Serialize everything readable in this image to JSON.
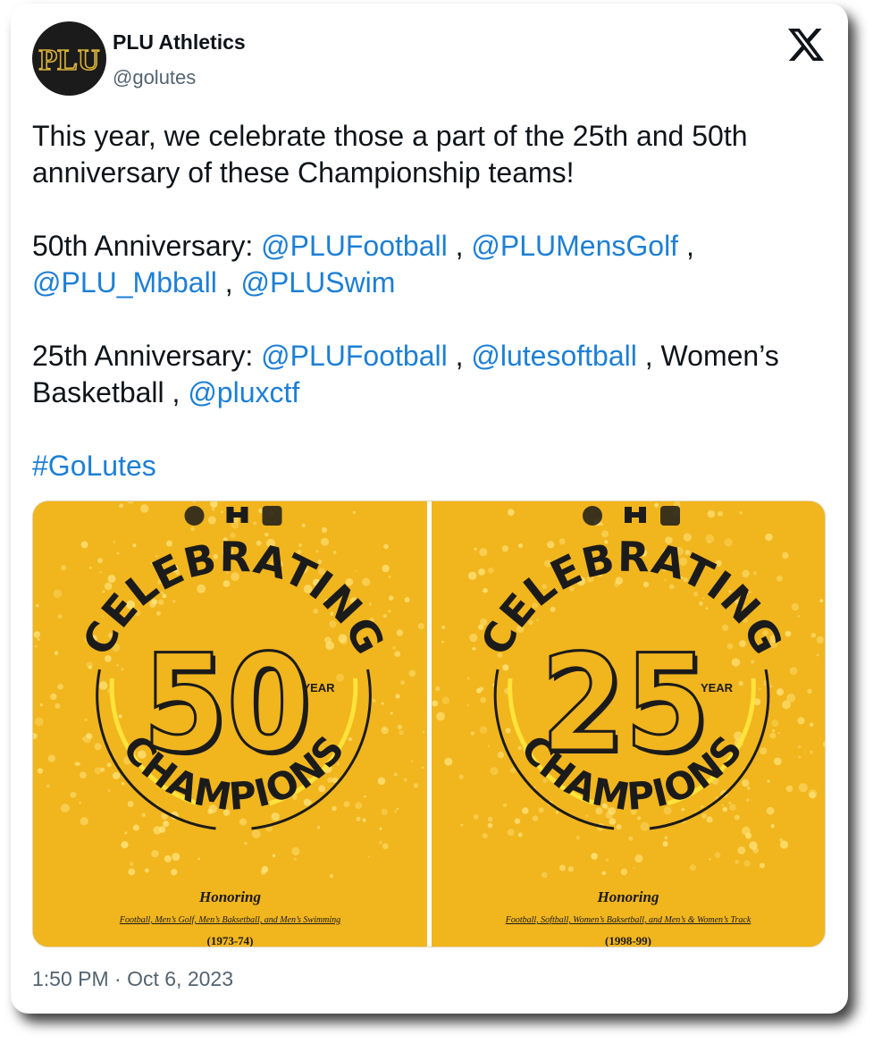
{
  "author": {
    "name": "PLU Athletics",
    "handle": "@golutes",
    "avatar_text": "PLU"
  },
  "brand_icon": "x-logo-icon",
  "tweet": {
    "line1": "This year, we celebrate those a part of the 25th and 50th anniversary of these Championship teams!",
    "fifty_label": "50th Anniversary: ",
    "fifty_m1": "@PLUFootball",
    "fifty_m2": "@PLUMensGolf",
    "fifty_m3": "@PLU_Mbball",
    "fifty_m4": "@PLUSwim",
    "twentyfive_label": "25th Anniversary: ",
    "twentyfive_m1": "@PLUFootball",
    "twentyfive_m2": "@lutesoftball",
    "twentyfive_text": "Women’s Basketball",
    "twentyfive_m3": "@pluxctf",
    "hashtag": "#GoLutes",
    "sep": " , "
  },
  "media": [
    {
      "top": "CELEBRATING",
      "number": "50",
      "year": "YEAR",
      "bottom": "CHAMPIONS",
      "honoring": "Honoring",
      "sports": "Football, Men’s Golf, Men’s Baksetball, and Men’s Swimming",
      "season": "(1973-74)"
    },
    {
      "top": "CELEBRATING",
      "number": "25",
      "year": "YEAR",
      "bottom": "CHAMPIONS",
      "honoring": "Honoring",
      "sports": "Football, Softball, Women’s Baksetball, and Men’s & Women’s Track",
      "season": "(1998-99)"
    }
  ],
  "timestamp": "1:50 PM · Oct 6, 2023",
  "colors": {
    "link": "#1d7fd4",
    "poster_bg": "#f1b51e",
    "accent_yellow": "#ffe23a"
  }
}
